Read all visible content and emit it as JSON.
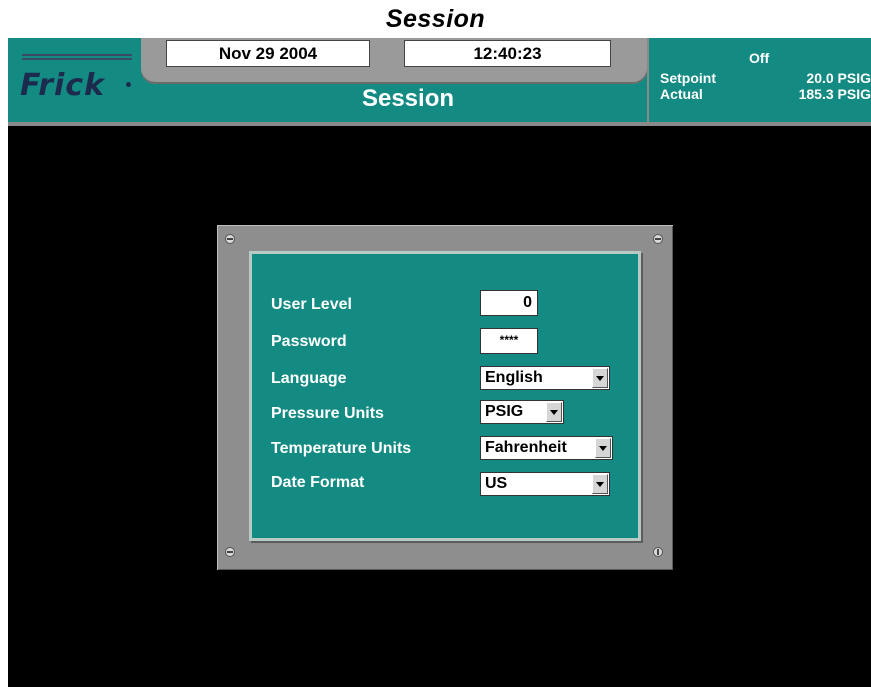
{
  "document": {
    "title": "Session"
  },
  "header": {
    "logo": "Frick",
    "date": "Nov 29 2004",
    "time": "12:40:23",
    "page_title": "Session",
    "status": "Off",
    "setpoint_label": "Setpoint",
    "setpoint_value": "20.0 PSIG",
    "actual_label": "Actual",
    "actual_value": "185.3 PSIG"
  },
  "session": {
    "user_level": {
      "label": "User Level",
      "value": "0"
    },
    "password": {
      "label": "Password",
      "value": "****"
    },
    "language": {
      "label": "Language",
      "value": "English"
    },
    "pressure_units": {
      "label": "Pressure Units",
      "value": "PSIG"
    },
    "temperature_units": {
      "label": "Temperature Units",
      "value": "Fahrenheit"
    },
    "date_format": {
      "label": "Date Format",
      "value": "US"
    }
  },
  "colors": {
    "header_teal": "#138a82",
    "frame_gray": "#8e8e8e",
    "background": "#000000"
  }
}
